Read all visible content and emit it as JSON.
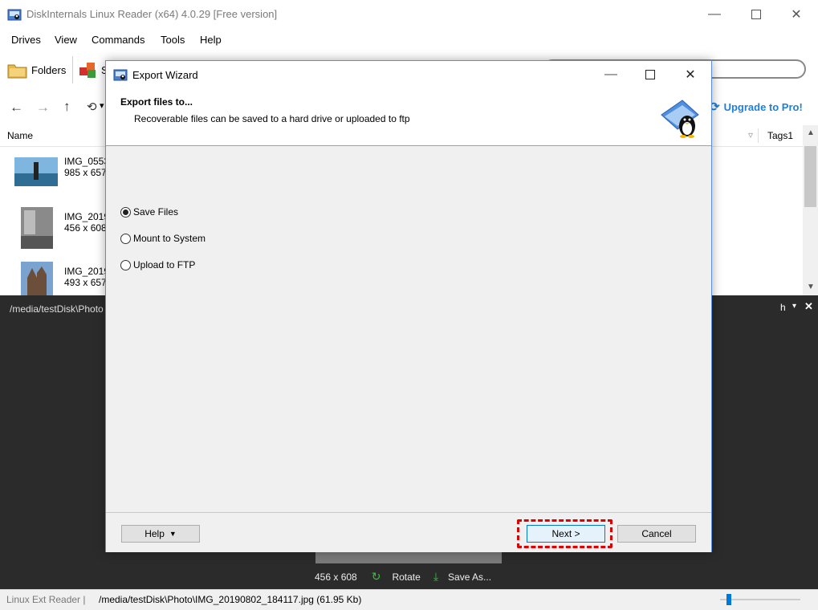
{
  "app": {
    "title": "DiskInternals Linux Reader (x64) 4.0.29 [Free version]"
  },
  "menu": [
    "Drives",
    "View",
    "Commands",
    "Tools",
    "Help"
  ],
  "toolbar": {
    "folders_label": "Folders",
    "truncated_label": "S"
  },
  "nav": {
    "history_arrow": "▾",
    "upgrade_label": "Upgrade to Pro!"
  },
  "list": {
    "col_name": "Name",
    "col_tags": "Tags1",
    "items": [
      {
        "name": "IMG_0553",
        "dims": "985 x 657"
      },
      {
        "name": "IMG_2019",
        "dims": "456 x 608"
      },
      {
        "name": "IMG_2019",
        "dims": "493 x 657"
      }
    ]
  },
  "preview": {
    "path": "/media/testDisk\\Photo",
    "right_label": "h",
    "dims": "456 x 608",
    "rotate_label": "Rotate",
    "save_as_label": "Save As..."
  },
  "status": {
    "left": "Linux Ext Reader |",
    "path": "/media/testDisk\\Photo\\IMG_20190802_184117.jpg (61.95 Kb)",
    "zoom_fraction": 0.08
  },
  "dialog": {
    "title": "Export Wizard",
    "header_title": "Export files to...",
    "header_subtitle": "Recoverable files can be saved to a hard drive or uploaded to ftp",
    "options": [
      {
        "label": "Save Files",
        "selected": true
      },
      {
        "label": "Mount to System",
        "selected": false
      },
      {
        "label": "Upload to FTP",
        "selected": false
      }
    ],
    "help_label": "Help",
    "next_label": "Next >",
    "cancel_label": "Cancel",
    "highlight_color": "#e00000"
  },
  "colors": {
    "accent": "#0078d7",
    "dark_panel": "#2b2b2b"
  }
}
